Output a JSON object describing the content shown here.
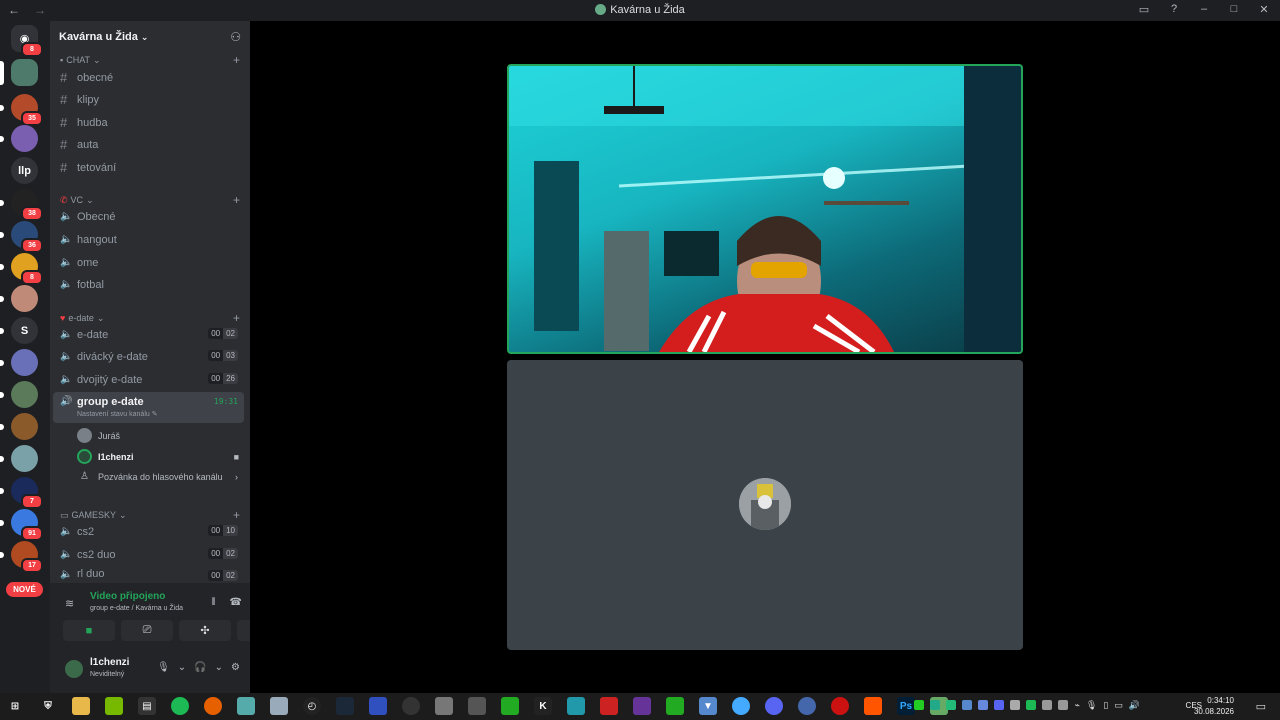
{
  "window": {
    "title": "Kavárna u Žida"
  },
  "server": {
    "name": "Kavárna u Žida"
  },
  "guild_badges": [
    "8",
    "35",
    "38",
    "36",
    "8",
    "7",
    "91",
    "17"
  ],
  "guild_letters": {
    "llp": "llp",
    "s": "S"
  },
  "nove_label": "NOVÉ",
  "categories": {
    "chat": "CHAT",
    "vc": "VC",
    "edate": "e-date",
    "gamesky": "GAMESKY"
  },
  "text_channels": [
    "obecné",
    "klipy",
    "hudba",
    "auta",
    "tetování"
  ],
  "vc_channels": [
    "Obecné",
    "hangout",
    "ome",
    "fotbal"
  ],
  "edate_channels": [
    {
      "name": "e-date",
      "a": "00",
      "b": "02"
    },
    {
      "name": "divácký e-date",
      "a": "00",
      "b": "03"
    },
    {
      "name": "dvojitý e-date",
      "a": "00",
      "b": "26"
    }
  ],
  "active_channel": {
    "name": "group e-date",
    "time": "19:31",
    "status": "Nastavení stavu kanálu"
  },
  "members": [
    "Juráš",
    "l1chenzi"
  ],
  "invite_label": "Pozvánka do hlasového kanálu",
  "gamesky_channels": [
    {
      "name": "cs2",
      "a": "00",
      "b": "10"
    },
    {
      "name": "cs2 duo",
      "a": "00",
      "b": "02"
    },
    {
      "name": "rl duo",
      "a": "00",
      "b": "02"
    }
  ],
  "voice_status": {
    "title": "Video připojeno",
    "subtitle": "group e-date / Kavárna u Žida"
  },
  "user": {
    "name": "l1chenzi",
    "status": "Neviditelný"
  },
  "taskbar": {
    "lang": "CES",
    "time": "0:34:10",
    "date": "30.08.2026"
  },
  "colors": {
    "accent_green": "#23a55a",
    "badge_red": "#f23f43",
    "sidebar": "#2b2d31",
    "rail": "#1e1f22"
  }
}
